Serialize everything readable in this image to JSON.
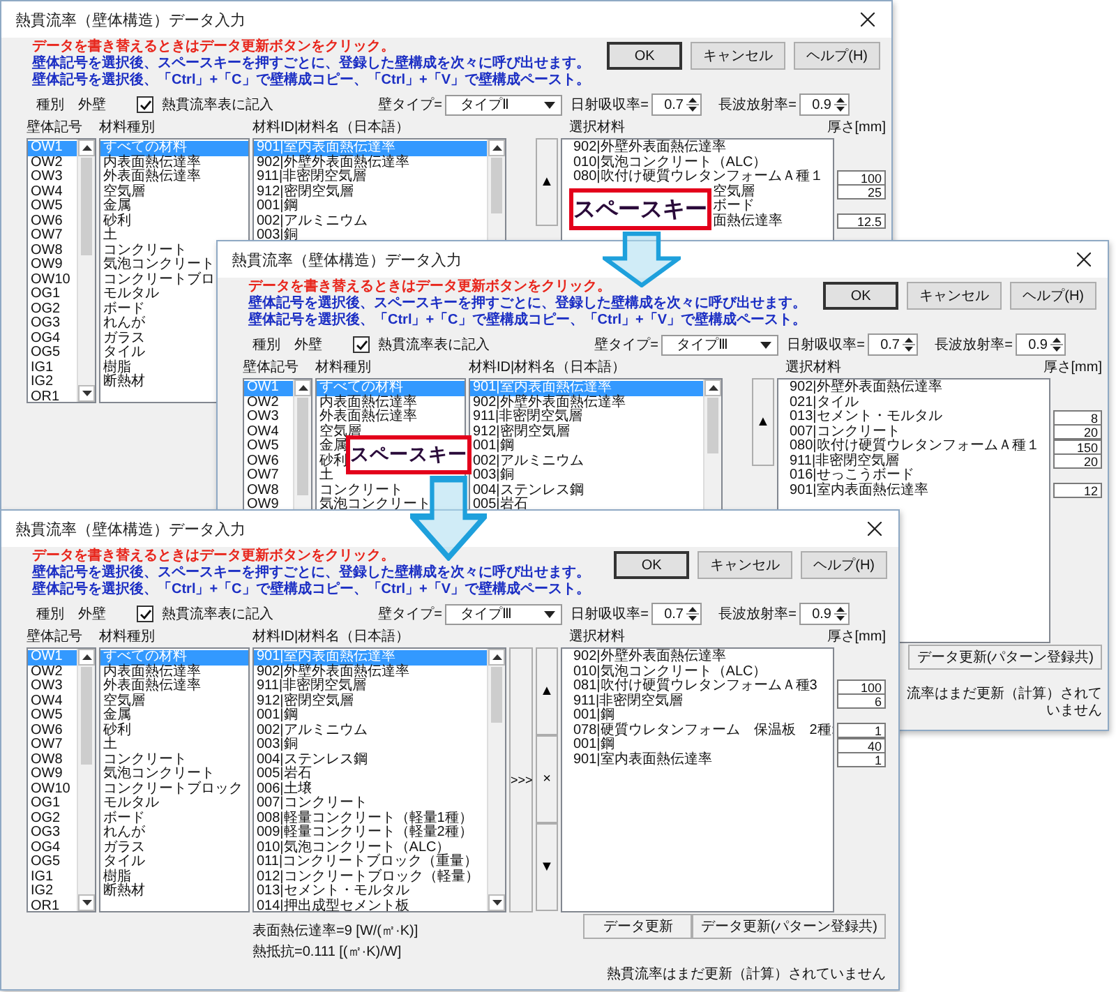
{
  "windows": [
    {
      "title": "熱貫流率（壁体構造）データ入力",
      "messages": [
        {
          "text": "データを書き替えるときはデータ更新ボタンをクリック。",
          "kind": "warning"
        },
        {
          "text": "壁体記号を選択後、スペースキーを押すごとに、登録した壁構成を次々に呼び出せます。",
          "kind": "info"
        },
        {
          "text": "壁体記号を選択後、「Ctrl」+「C」で壁構成コピー、「Ctrl」+「V」で壁構成ペースト。",
          "kind": "info"
        }
      ],
      "buttons": [
        "OK",
        "キャンセル",
        "ヘルプ(H)"
      ],
      "type_label": "種別",
      "type_value": "外壁",
      "record_checkbox": {
        "label": "熱貫流率表に記入",
        "checked": true
      },
      "wall_type": {
        "label": "壁タイプ=",
        "value": "タイプⅡ"
      },
      "solar": {
        "label": "日射吸収率=",
        "value": "0.7"
      },
      "longwave": {
        "label": "長波放射率=",
        "value": "0.9"
      },
      "headers": {
        "wall_code": "壁体記号",
        "category": "材料種別",
        "material": "材料ID|材料名（日本語）",
        "selected": "選択材料",
        "thickness": "厚さ[mm]"
      },
      "wall_codes": [
        {
          "label": "OW1",
          "selected": true
        },
        {
          "label": "OW2",
          "selected": false
        },
        {
          "label": "OW3",
          "selected": false
        },
        {
          "label": "OW4",
          "selected": false
        },
        {
          "label": "OW5",
          "selected": false
        },
        {
          "label": "OW6",
          "selected": false
        },
        {
          "label": "OW7",
          "selected": false
        },
        {
          "label": "OW8",
          "selected": false
        },
        {
          "label": "OW9",
          "selected": false
        },
        {
          "label": "OW10",
          "selected": false
        },
        {
          "label": "OG1",
          "selected": false
        },
        {
          "label": "OG2",
          "selected": false
        },
        {
          "label": "OG3",
          "selected": false
        },
        {
          "label": "OG4",
          "selected": false
        },
        {
          "label": "OG5",
          "selected": false
        },
        {
          "label": "IG1",
          "selected": false
        },
        {
          "label": "IG2",
          "selected": false
        },
        {
          "label": "OR1",
          "selected": false
        }
      ],
      "categories": [
        {
          "label": "すべての材料",
          "selected": true
        },
        {
          "label": "内表面熱伝達率",
          "selected": false
        },
        {
          "label": "外表面熱伝達率",
          "selected": false
        },
        {
          "label": "空気層",
          "selected": false
        },
        {
          "label": "金属",
          "selected": false
        },
        {
          "label": "砂利",
          "selected": false
        },
        {
          "label": "土",
          "selected": false
        },
        {
          "label": "コンクリート",
          "selected": false
        },
        {
          "label": "気泡コンクリート",
          "selected": false
        },
        {
          "label": "コンクリートブロ",
          "selected": false
        },
        {
          "label": "モルタル",
          "selected": false
        },
        {
          "label": "ボード",
          "selected": false
        },
        {
          "label": "れんが",
          "selected": false
        },
        {
          "label": "ガラス",
          "selected": false
        },
        {
          "label": "タイル",
          "selected": false
        },
        {
          "label": "樹脂",
          "selected": false
        },
        {
          "label": "断熱材",
          "selected": false
        }
      ],
      "materials": [
        {
          "label": "901|室内表面熱伝達率",
          "selected": true
        },
        {
          "label": "902|外壁外表面熱伝達率",
          "selected": false
        },
        {
          "label": "911|非密閉空気層",
          "selected": false
        },
        {
          "label": "912|密閉空気層",
          "selected": false
        },
        {
          "label": "001|鋼",
          "selected": false
        },
        {
          "label": "002|アルミニウム",
          "selected": false
        },
        {
          "label": "003|銅",
          "selected": false
        }
      ],
      "move_buttons": [
        "▲"
      ],
      "selected_materials": [
        {
          "label": "902|外壁外表面熱伝達率",
          "kind": "full"
        },
        {
          "label": "010|気泡コンクリート（ALC）",
          "thickness": "100",
          "kind": "full"
        },
        {
          "label": "080|吹付け硬質ウレタンフォームＡ種１",
          "thickness": "25",
          "kind": "full"
        },
        {
          "label": "空気層",
          "kind": "covered"
        },
        {
          "label": "ボード",
          "thickness": "12.5",
          "kind": "covered"
        },
        {
          "label": "面熱伝達率",
          "kind": "covered"
        }
      ]
    },
    {
      "title": "熱貫流率（壁体構造）データ入力",
      "messages": [
        {
          "text": "データを書き替えるときはデータ更新ボタンをクリック。",
          "kind": "warning"
        },
        {
          "text": "壁体記号を選択後、スペースキーを押すごとに、登録した壁構成を次々に呼び出せます。",
          "kind": "info"
        },
        {
          "text": "壁体記号を選択後、「Ctrl」+「C」で壁構成コピー、「Ctrl」+「V」で壁構成ペースト。",
          "kind": "info"
        }
      ],
      "buttons": [
        "OK",
        "キャンセル",
        "ヘルプ(H)"
      ],
      "type_label": "種別",
      "type_value": "外壁",
      "record_checkbox": {
        "label": "熱貫流率表に記入",
        "checked": true
      },
      "wall_type": {
        "label": "壁タイプ=",
        "value": "タイプⅢ"
      },
      "solar": {
        "label": "日射吸収率=",
        "value": "0.7"
      },
      "longwave": {
        "label": "長波放射率=",
        "value": "0.9"
      },
      "headers": {
        "wall_code": "壁体記号",
        "category": "材料種別",
        "material": "材料ID|材料名（日本語）",
        "selected": "選択材料",
        "thickness": "厚さ[mm]"
      },
      "wall_codes": [
        {
          "label": "OW1",
          "selected": true
        },
        {
          "label": "OW2",
          "selected": false
        },
        {
          "label": "OW3",
          "selected": false
        },
        {
          "label": "OW4",
          "selected": false
        },
        {
          "label": "OW5",
          "selected": false
        },
        {
          "label": "OW6",
          "selected": false
        },
        {
          "label": "OW7",
          "selected": false
        },
        {
          "label": "OW8",
          "selected": false
        },
        {
          "label": "OW9",
          "selected": false
        }
      ],
      "categories": [
        {
          "label": "すべての材料",
          "selected": true
        },
        {
          "label": "内表面熱伝達率",
          "selected": false
        },
        {
          "label": "外表面熱伝達率",
          "selected": false
        },
        {
          "label": "空気層",
          "selected": false
        },
        {
          "label": "金属",
          "selected": false
        },
        {
          "label": "砂利",
          "selected": false
        },
        {
          "label": "土",
          "selected": false
        },
        {
          "label": "コンクリート",
          "selected": false
        },
        {
          "label": "気泡コンクリート",
          "selected": false
        }
      ],
      "materials": [
        {
          "label": "901|室内表面熱伝達率",
          "selected": true
        },
        {
          "label": "902|外壁外表面熱伝達率",
          "selected": false
        },
        {
          "label": "911|非密閉空気層",
          "selected": false
        },
        {
          "label": "912|密閉空気層",
          "selected": false
        },
        {
          "label": "001|鋼",
          "selected": false
        },
        {
          "label": "002|アルミニウム",
          "selected": false
        },
        {
          "label": "003|銅",
          "selected": false
        },
        {
          "label": "004|ステンレス鋼",
          "selected": false
        },
        {
          "label": "005|岩石",
          "selected": false
        }
      ],
      "move_buttons": [
        "▲"
      ],
      "selected_materials": [
        {
          "label": "902|外壁外表面熱伝達率"
        },
        {
          "label": "021|タイル",
          "thickness": "8"
        },
        {
          "label": "013|セメント・モルタル",
          "thickness": "20"
        },
        {
          "label": "007|コンクリート",
          "thickness": "150"
        },
        {
          "label": "080|吹付け硬質ウレタンフォームＡ種１",
          "thickness": "20"
        },
        {
          "label": "911|非密閉空気層"
        },
        {
          "label": "016|せっこうボード",
          "thickness": "12"
        },
        {
          "label": "901|室内表面熱伝達率"
        }
      ],
      "update_buttons": [
        "データ更新(パターン登録共)"
      ],
      "status": "流率はまだ更新（計算）されていません"
    },
    {
      "title": "熱貫流率（壁体構造）データ入力",
      "messages": [
        {
          "text": "データを書き替えるときはデータ更新ボタンをクリック。",
          "kind": "warning"
        },
        {
          "text": "壁体記号を選択後、スペースキーを押すごとに、登録した壁構成を次々に呼び出せます。",
          "kind": "info"
        },
        {
          "text": "壁体記号を選択後、「Ctrl」+「C」で壁構成コピー、「Ctrl」+「V」で壁構成ペースト。",
          "kind": "info"
        }
      ],
      "buttons": [
        "OK",
        "キャンセル",
        "ヘルプ(H)"
      ],
      "type_label": "種別",
      "type_value": "外壁",
      "record_checkbox": {
        "label": "熱貫流率表に記入",
        "checked": true
      },
      "wall_type": {
        "label": "壁タイプ=",
        "value": "タイプⅢ"
      },
      "solar": {
        "label": "日射吸収率=",
        "value": "0.7"
      },
      "longwave": {
        "label": "長波放射率=",
        "value": "0.9"
      },
      "headers": {
        "wall_code": "壁体記号",
        "category": "材料種別",
        "material": "材料ID|材料名（日本語）",
        "selected": "選択材料",
        "thickness": "厚さ[mm]"
      },
      "wall_codes": [
        {
          "label": "OW1",
          "selected": true
        },
        {
          "label": "OW2",
          "selected": false
        },
        {
          "label": "OW3",
          "selected": false
        },
        {
          "label": "OW4",
          "selected": false
        },
        {
          "label": "OW5",
          "selected": false
        },
        {
          "label": "OW6",
          "selected": false
        },
        {
          "label": "OW7",
          "selected": false
        },
        {
          "label": "OW8",
          "selected": false
        },
        {
          "label": "OW9",
          "selected": false
        },
        {
          "label": "OW10",
          "selected": false
        },
        {
          "label": "OG1",
          "selected": false
        },
        {
          "label": "OG2",
          "selected": false
        },
        {
          "label": "OG3",
          "selected": false
        },
        {
          "label": "OG4",
          "selected": false
        },
        {
          "label": "OG5",
          "selected": false
        },
        {
          "label": "IG1",
          "selected": false
        },
        {
          "label": "IG2",
          "selected": false
        },
        {
          "label": "OR1",
          "selected": false
        }
      ],
      "categories": [
        {
          "label": "すべての材料",
          "selected": true
        },
        {
          "label": "内表面熱伝達率",
          "selected": false
        },
        {
          "label": "外表面熱伝達率",
          "selected": false
        },
        {
          "label": "空気層",
          "selected": false
        },
        {
          "label": "金属",
          "selected": false
        },
        {
          "label": "砂利",
          "selected": false
        },
        {
          "label": "土",
          "selected": false
        },
        {
          "label": "コンクリート",
          "selected": false
        },
        {
          "label": "気泡コンクリート",
          "selected": false
        },
        {
          "label": "コンクリートブロック",
          "selected": false
        },
        {
          "label": "モルタル",
          "selected": false
        },
        {
          "label": "ボード",
          "selected": false
        },
        {
          "label": "れんが",
          "selected": false
        },
        {
          "label": "ガラス",
          "selected": false
        },
        {
          "label": "タイル",
          "selected": false
        },
        {
          "label": "樹脂",
          "selected": false
        },
        {
          "label": "断熱材",
          "selected": false
        }
      ],
      "materials": [
        {
          "label": "901|室内表面熱伝達率",
          "selected": true
        },
        {
          "label": "902|外壁外表面熱伝達率",
          "selected": false
        },
        {
          "label": "911|非密閉空気層",
          "selected": false
        },
        {
          "label": "912|密閉空気層",
          "selected": false
        },
        {
          "label": "001|鋼",
          "selected": false
        },
        {
          "label": "002|アルミニウム",
          "selected": false
        },
        {
          "label": "003|銅",
          "selected": false
        },
        {
          "label": "004|ステンレス鋼",
          "selected": false
        },
        {
          "label": "005|岩石",
          "selected": false
        },
        {
          "label": "006|土壌",
          "selected": false
        },
        {
          "label": "007|コンクリート",
          "selected": false
        },
        {
          "label": "008|軽量コンクリート（軽量1種）",
          "selected": false
        },
        {
          "label": "009|軽量コンクリート（軽量2種）",
          "selected": false
        },
        {
          "label": "010|気泡コンクリート（ALC）",
          "selected": false
        },
        {
          "label": "011|コンクリートブロック（重量）",
          "selected": false
        },
        {
          "label": "012|コンクリートブロック（軽量）",
          "selected": false
        },
        {
          "label": "013|セメント・モルタル",
          "selected": false
        },
        {
          "label": "014|押出成型セメント板",
          "selected": false
        }
      ],
      "add_button": ">>>",
      "move_buttons": [
        "▲",
        "×",
        "▼"
      ],
      "selected_materials": [
        {
          "label": "902|外壁外表面熱伝達率"
        },
        {
          "label": "010|気泡コンクリート（ALC）",
          "thickness": "100"
        },
        {
          "label": "081|吹付け硬質ウレタンフォームＡ種3",
          "thickness": "6"
        },
        {
          "label": "911|非密閉空気層"
        },
        {
          "label": "001|鋼",
          "thickness": "1"
        },
        {
          "label": "078|硬質ウレタンフォーム　保温板　2種:",
          "thickness": "40"
        },
        {
          "label": "001|鋼",
          "thickness": "1"
        },
        {
          "label": "901|室内表面熱伝達率"
        }
      ],
      "info": [
        "表面熱伝達率=9 [W/(㎡·K)]",
        "熱抵抗=0.111 [(㎡·K)/W]"
      ],
      "update_buttons": [
        "データ更新",
        "データ更新(パターン登録共)"
      ],
      "status": "熱貫流率はまだ更新（計算）されていません"
    }
  ],
  "callouts": [
    "スペースキー",
    "スペースキー"
  ]
}
